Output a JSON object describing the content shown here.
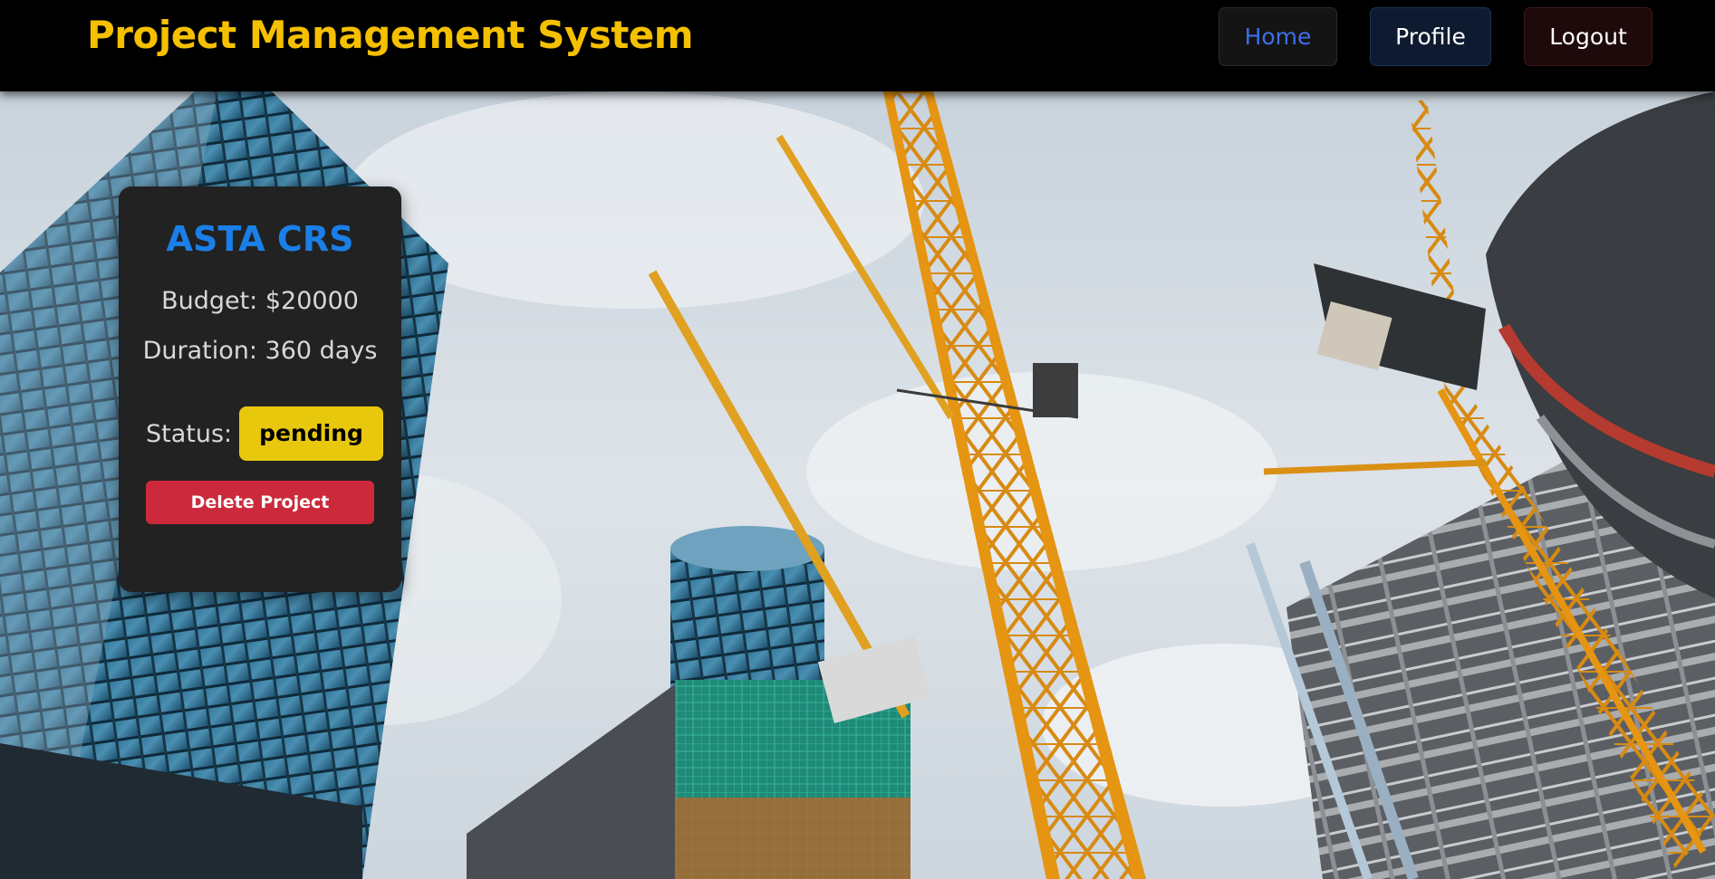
{
  "navbar": {
    "title": "Project Management System",
    "items": [
      {
        "label": "Home"
      },
      {
        "label": "Profile"
      },
      {
        "label": "Logout"
      }
    ]
  },
  "project": {
    "name": "ASTA CRS",
    "budget_text": "Budget: $20000",
    "duration_text": "Duration: 360 days",
    "status_label": "Status:",
    "status_value": "pending",
    "delete_label": "Delete Project"
  },
  "colors": {
    "brand": "#f5c000",
    "home_link": "#3d6fe8",
    "project_title": "#1a7fe8",
    "status_badge": "#e8c80c",
    "delete_button": "#cc2a3c",
    "card_bg": "#222222"
  }
}
